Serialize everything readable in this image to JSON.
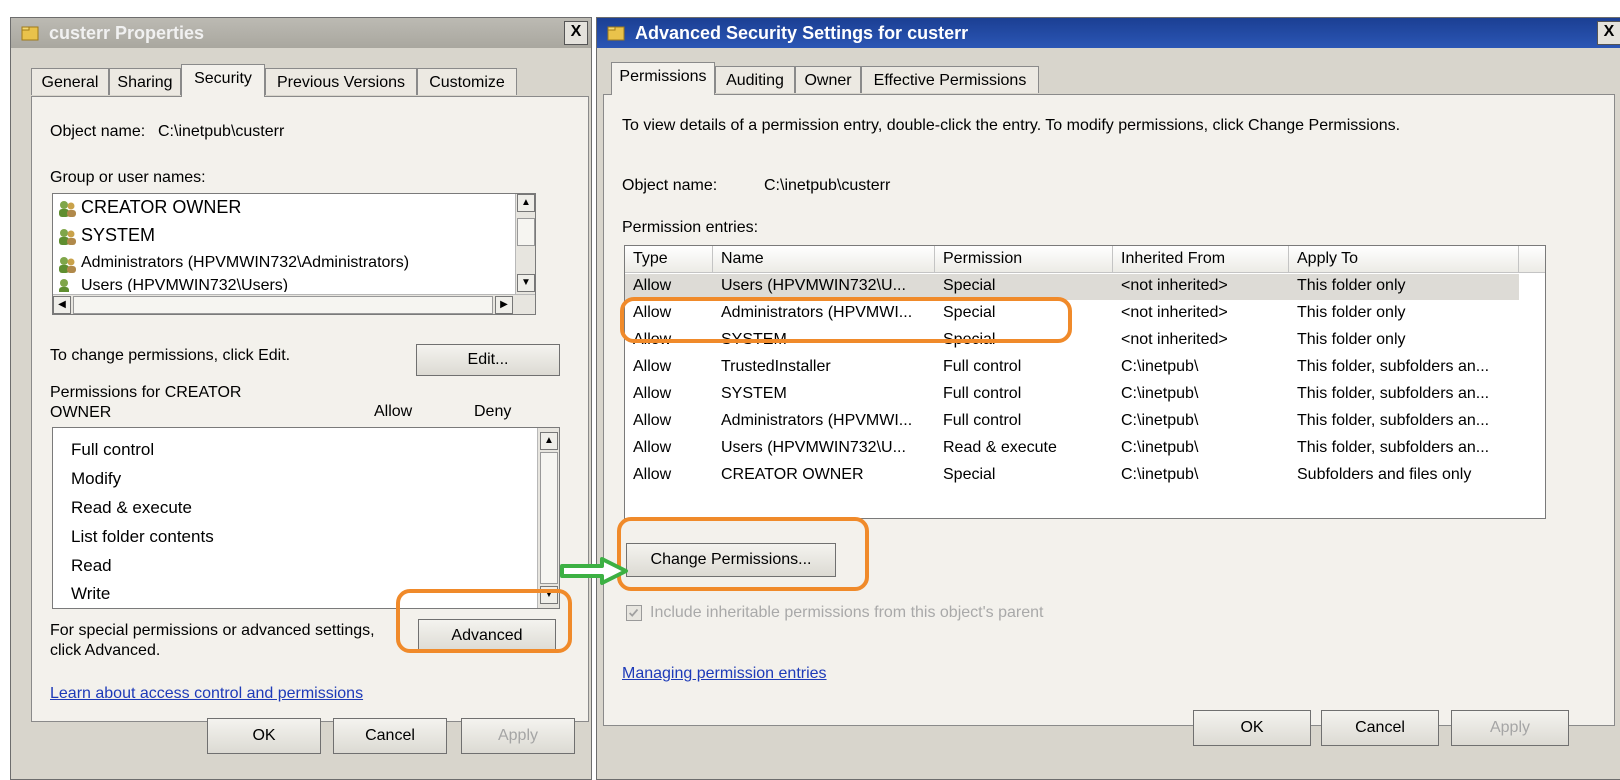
{
  "left_window": {
    "title": "custerr Properties",
    "close_glyph": "X",
    "tabs": [
      "General",
      "Sharing",
      "Security",
      "Previous Versions",
      "Customize"
    ],
    "object_name_label": "Object name:",
    "object_name_value": "C:\\inetpub\\custerr",
    "group_label": "Group or user names:",
    "groups": [
      "CREATOR OWNER",
      "SYSTEM",
      "Administrators (HPVMWIN732\\Administrators)",
      "Users (HPVMWIN732\\Users)"
    ],
    "change_text": "To change permissions, click Edit.",
    "edit_button": "Edit...",
    "permissions_for_line1": "Permissions for CREATOR",
    "permissions_for_line2": "OWNER",
    "allow_header": "Allow",
    "deny_header": "Deny",
    "permissions": [
      "Full control",
      "Modify",
      "Read & execute",
      "List folder contents",
      "Read",
      "Write"
    ],
    "special_text_line1": "For special permissions or advanced settings,",
    "special_text_line2": "click Advanced.",
    "advanced_button": "Advanced",
    "learn_link": "Learn about access control and permissions",
    "ok_button": "OK",
    "cancel_button": "Cancel",
    "apply_button": "Apply"
  },
  "right_window": {
    "title": "Advanced Security Settings for custerr",
    "close_glyph": "X",
    "tabs": [
      "Permissions",
      "Auditing",
      "Owner",
      "Effective Permissions"
    ],
    "instruction": "To view details of a permission entry, double-click the entry. To modify permissions, click Change Permissions.",
    "object_name_label": "Object name:",
    "object_name_value": "C:\\inetpub\\custerr",
    "entries_label": "Permission entries:",
    "columns": [
      "Type",
      "Name",
      "Permission",
      "Inherited From",
      "Apply To"
    ],
    "rows": [
      [
        "Allow",
        "Users (HPVMWIN732\\U...",
        "Special",
        "<not inherited>",
        "This folder only"
      ],
      [
        "Allow",
        "Administrators (HPVMWI...",
        "Special",
        "<not inherited>",
        "This folder only"
      ],
      [
        "Allow",
        "SYSTEM",
        "Special",
        "<not inherited>",
        "This folder only"
      ],
      [
        "Allow",
        "TrustedInstaller",
        "Full control",
        "C:\\inetpub\\",
        "This folder, subfolders an..."
      ],
      [
        "Allow",
        "SYSTEM",
        "Full control",
        "C:\\inetpub\\",
        "This folder, subfolders an..."
      ],
      [
        "Allow",
        "Administrators (HPVMWI...",
        "Full control",
        "C:\\inetpub\\",
        "This folder, subfolders an..."
      ],
      [
        "Allow",
        "Users (HPVMWIN732\\U...",
        "Read & execute",
        "C:\\inetpub\\",
        "This folder, subfolders an..."
      ],
      [
        "Allow",
        "CREATOR OWNER",
        "Special",
        "C:\\inetpub\\",
        "Subfolders and files only"
      ]
    ],
    "change_permissions_button": "Change Permissions...",
    "include_inheritable": "Include inheritable permissions from this object's parent",
    "managing_link": "Managing permission entries",
    "ok_button": "OK",
    "cancel_button": "Cancel",
    "apply_button": "Apply"
  },
  "colors": {
    "highlight_orange": "#f08a2a",
    "arrow_green": "#3cb043",
    "title_active": "#1b3f93",
    "link_blue": "#1d3ab8"
  }
}
